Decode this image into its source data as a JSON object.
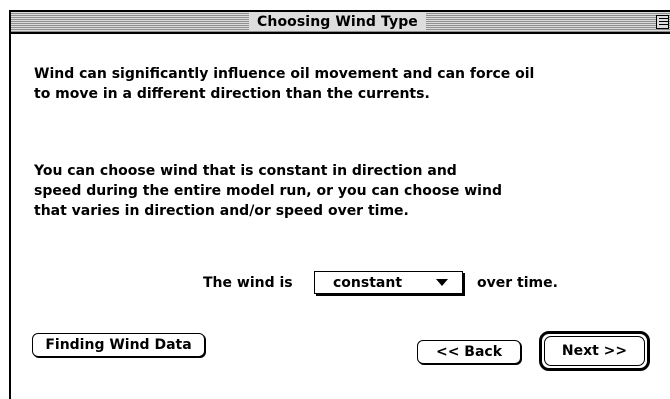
{
  "window": {
    "title": "Choosing Wind Type"
  },
  "body": {
    "paragraph_1": "Wind can significantly influence oil movement and can force oil\nto move in a different direction than the currents.",
    "paragraph_2": "You can choose wind that is constant in direction and\nspeed during the entire model run, or you can choose wind\nthat varies in direction and/or speed over time."
  },
  "wind_row": {
    "prefix": "The wind is",
    "selected_value": "constant",
    "suffix": "over time."
  },
  "buttons": {
    "finding_wind_data": "Finding Wind Data",
    "back": "<< Back",
    "next": "Next >>"
  },
  "icons": {
    "dropdown_arrow": "triangle-down-icon",
    "window_zoom": "zoom-box-icon"
  },
  "colors": {
    "title_bar": "#dddddd",
    "background": "#ffffff",
    "text": "#000000"
  }
}
